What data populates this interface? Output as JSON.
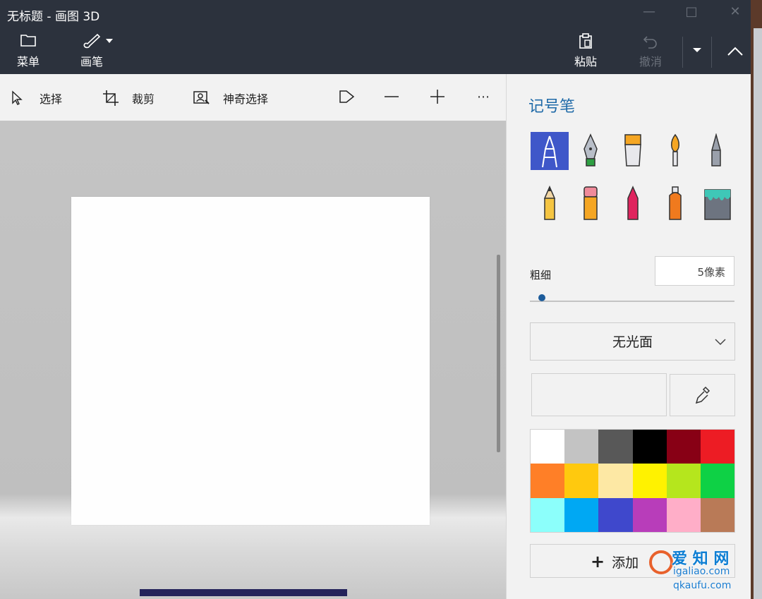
{
  "window": {
    "title": "无标题 - 画图 3D",
    "controls": [
      "minimize-icon",
      "maximize-icon",
      "close-icon"
    ]
  },
  "ribbon": {
    "menu_label": "菜单",
    "brushes_label": "画笔",
    "paste_label": "粘贴",
    "undo_label": "撤消"
  },
  "toolstrip": {
    "select_label": "选择",
    "crop_label": "裁剪",
    "magic_select_label": "神奇选择"
  },
  "panel": {
    "title": "记号笔",
    "brushes": [
      {
        "name": "marker",
        "selected": true
      },
      {
        "name": "calligraphy-pen",
        "selected": false
      },
      {
        "name": "oil-brush",
        "selected": false
      },
      {
        "name": "watercolor",
        "selected": false
      },
      {
        "name": "pixel-pen",
        "selected": false
      },
      {
        "name": "pencil",
        "selected": false
      },
      {
        "name": "eraser",
        "selected": false
      },
      {
        "name": "crayon",
        "selected": false
      },
      {
        "name": "spray-can",
        "selected": false
      },
      {
        "name": "fill-bucket",
        "selected": false
      }
    ],
    "thickness_label": "粗细",
    "thickness_value": "5像素",
    "finish_value": "无光面",
    "add_color_label": "添加"
  },
  "palette": [
    "#ffffff",
    "#c3c3c3",
    "#585858",
    "#000000",
    "#880015",
    "#ed1c24",
    "#ff7f27",
    "#ffc90e",
    "#fde8a4",
    "#fff200",
    "#b5e61d",
    "#0ed145",
    "#8cfffb",
    "#00a8f3",
    "#3f48cc",
    "#b83dba",
    "#ffaec8",
    "#b97a57"
  ],
  "colors": {
    "titlebar_bg": "#2c323d",
    "accent": "#1f6aa8",
    "selected_brush_bg": "#3f57c9"
  },
  "watermark": {
    "line1": "爱 知 网",
    "line2": "igaliao.com",
    "line3": "qkaufu.com"
  }
}
